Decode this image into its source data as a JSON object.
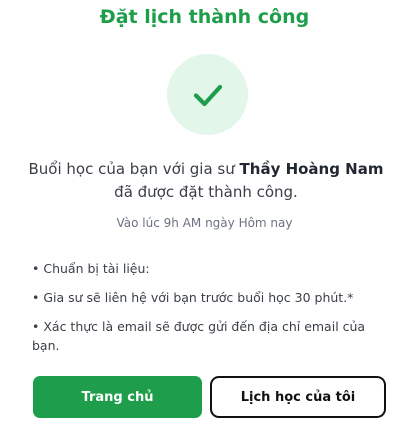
{
  "header": {
    "title": "Đặt lịch thành công"
  },
  "status_icon": {
    "name": "checkmark-icon",
    "color": "#1e9e4a",
    "background": "#e3f6ea"
  },
  "message": {
    "prefix": "Buổi học của bạn với gia sư ",
    "tutor_name": "Thầy Hoàng Nam",
    "suffix": " đã được đặt thành công."
  },
  "time_text": "Vào lúc 9h AM ngày Hôm nay",
  "notes": [
    "• Chuẩn bị tài liệu:",
    "• Gia sư sẽ liên hệ với bạn trước buổi học 30 phút.*",
    "• Xác thực là email sẽ được gửi đến địa chỉ email của bạn."
  ],
  "buttons": {
    "home_label": "Trang chủ",
    "schedule_label": "Lịch học của tôi"
  },
  "colors": {
    "accent": "#1e9e4a"
  }
}
